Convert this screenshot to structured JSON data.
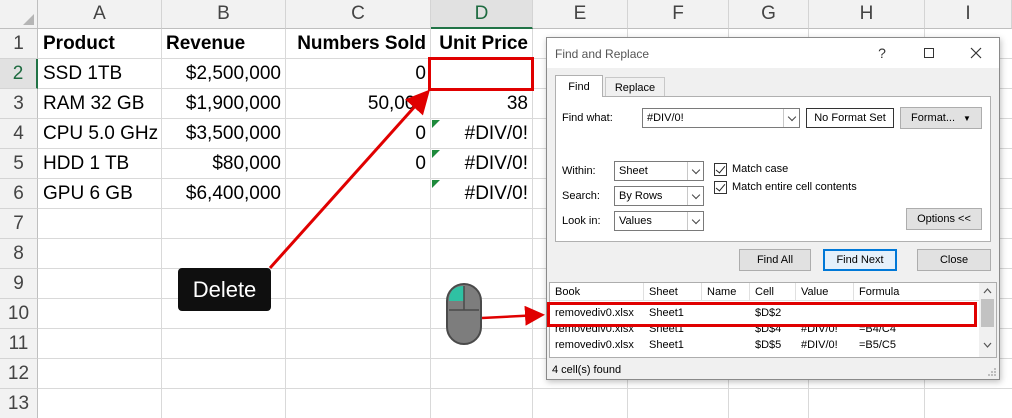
{
  "spreadsheet": {
    "columns": [
      "A",
      "B",
      "C",
      "D",
      "E",
      "F",
      "G",
      "H",
      "I"
    ],
    "rows": [
      "1",
      "2",
      "3",
      "4",
      "5",
      "6",
      "7",
      "8",
      "9",
      "10",
      "11",
      "12",
      "13"
    ],
    "headers": [
      "Product",
      "Revenue",
      "Numbers Sold",
      "Unit Price"
    ],
    "data": [
      [
        "SSD 1TB",
        "$2,500,000",
        "0",
        ""
      ],
      [
        "RAM 32 GB",
        "$1,900,000",
        "50,000",
        "38"
      ],
      [
        "CPU 5.0 GHz",
        "$3,500,000",
        "0",
        "#DIV/0!"
      ],
      [
        "HDD 1 TB",
        "$80,000",
        "0",
        "#DIV/0!"
      ],
      [
        "GPU 6 GB",
        "$6,400,000",
        "",
        "#DIV/0!"
      ]
    ],
    "selected_column": "D",
    "selected_row": "2",
    "colors": {
      "selected_header": "#217346",
      "error_indicator": "#1e8a3c"
    }
  },
  "dialog": {
    "title": "Find and Replace",
    "tabs": [
      "Find",
      "Replace"
    ],
    "active_tab": "Find",
    "find_what_label": "Find what:",
    "find_what_value": "#DIV/0!",
    "no_format_label": "No Format Set",
    "format_button": "Format...",
    "within_label": "Within:",
    "within_value": "Sheet",
    "search_label": "Search:",
    "search_value": "By Rows",
    "lookin_label": "Look in:",
    "lookin_value": "Values",
    "match_case_label": "Match case",
    "match_case_checked": true,
    "match_entire_label": "Match entire cell contents",
    "match_entire_checked": true,
    "options_button": "Options <<",
    "find_all_button": "Find All",
    "find_next_button": "Find Next",
    "close_button": "Close",
    "results_columns": [
      "Book",
      "Sheet",
      "Name",
      "Cell",
      "Value",
      "Formula"
    ],
    "results_rows": [
      [
        "removediv0.xlsx",
        "Sheet1",
        "",
        "$D$2",
        "",
        ""
      ],
      [
        "removediv0.xlsx",
        "Sheet1",
        "",
        "$D$4",
        "#DIV/0!",
        "=B4/C4"
      ],
      [
        "removediv0.xlsx",
        "Sheet1",
        "",
        "$D$5",
        "#DIV/0!",
        "=B5/C5"
      ]
    ],
    "status_text": "4 cell(s) found"
  },
  "annotation": {
    "delete_key_label": "Delete",
    "highlight_color": "#e00000",
    "mouse_icon": "mouse-left-click-icon"
  }
}
